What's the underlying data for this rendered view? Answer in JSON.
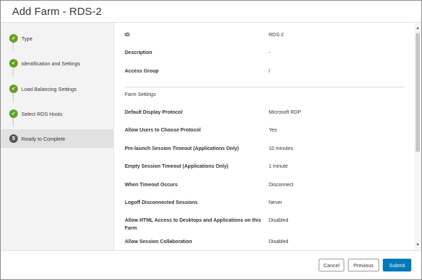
{
  "dialog": {
    "title": "Add Farm - RDS-2"
  },
  "sidebar": {
    "steps": [
      {
        "label": "Type",
        "state": "done",
        "icon": "check-icon"
      },
      {
        "label": "Identification and Settings",
        "state": "done",
        "icon": "check-icon"
      },
      {
        "label": "Load Balancing Settings",
        "state": "done",
        "icon": "check-icon"
      },
      {
        "label": "Select RDS Hosts",
        "state": "done",
        "icon": "check-icon"
      },
      {
        "label": "Ready to Complete",
        "state": "current",
        "number": "5"
      }
    ]
  },
  "summary": {
    "top_rows": [
      {
        "key": "ID",
        "value": "RDS-2"
      },
      {
        "key": "Description",
        "value": "-"
      },
      {
        "key": "Access Group",
        "value": "/"
      }
    ],
    "section_title": "Farm Settings",
    "settings_rows": [
      {
        "key": "Default Display Protocol",
        "value": "Microsoft RDP"
      },
      {
        "key": "Allow Users to Choose Protocol",
        "value": "Yes"
      },
      {
        "key": "Pre-launch Session Timeout (Applications Only)",
        "value": "10 minutes"
      },
      {
        "key": "Empty Session Timeout (Applications Only)",
        "value": "1 minute"
      },
      {
        "key": "When Timeout Occurs",
        "value": "Disconnect"
      },
      {
        "key": "Logoff Disconnected Sessions",
        "value": "Never"
      },
      {
        "key": "Allow HTML Access to Desktops and Applications on this Farm",
        "value": "Disabled"
      },
      {
        "key": "Allow Session Collaboration",
        "value": "Disabled"
      }
    ]
  },
  "footer": {
    "cancel_label": "Cancel",
    "previous_label": "Previous",
    "submit_label": "Submit"
  },
  "colors": {
    "done": "#62a420",
    "current": "#555555",
    "primary": "#0079b8"
  }
}
